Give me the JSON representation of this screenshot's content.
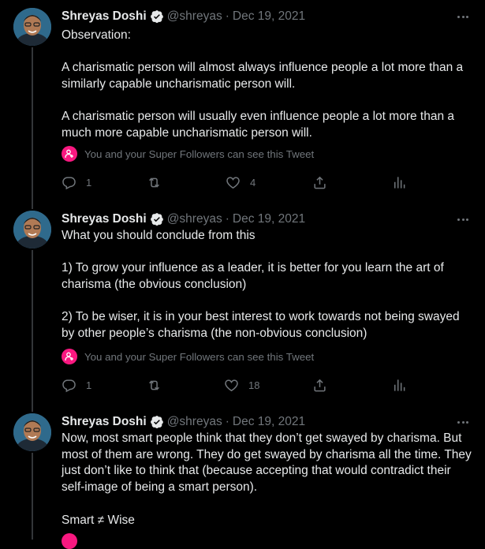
{
  "super_follow_notice": "You and your Super Followers can see this Tweet",
  "tweets": [
    {
      "name": "Shreyas Doshi",
      "handle": "@shreyas",
      "separator": "·",
      "date": "Dec 19, 2021",
      "paragraphs": [
        "Observation:",
        "A charismatic person will almost always influence people a lot more than a similarly capable uncharismatic person will.",
        "A charismatic person will usually even influence people a lot more than a much more capable uncharismatic person will."
      ],
      "reply_count": "1",
      "retweet_count": "",
      "like_count": "4"
    },
    {
      "name": "Shreyas Doshi",
      "handle": "@shreyas",
      "separator": "·",
      "date": "Dec 19, 2021",
      "paragraphs": [
        "What you should conclude from this",
        "1) To grow your influence as a leader, it is better for you learn the art of charisma (the obvious conclusion)",
        "2) To be wiser, it is in your best interest to work towards not being swayed by other people’s charisma (the non-obvious conclusion)"
      ],
      "reply_count": "1",
      "retweet_count": "",
      "like_count": "18"
    },
    {
      "name": "Shreyas Doshi",
      "handle": "@shreyas",
      "separator": "·",
      "date": "Dec 19, 2021",
      "paragraphs": [
        "Now, most smart people think that they don’t get swayed by charisma. But most of them are wrong. They do get swayed by charisma all the time. They just don’t like to think that (because accepting that would contradict their self-image of being a smart person).",
        "Smart ≠ Wise"
      ]
    }
  ],
  "icons": {
    "verified": "verified-badge-icon",
    "more": "more-options-icon",
    "reply": "reply-icon",
    "retweet": "retweet-icon",
    "like": "heart-icon",
    "share": "share-icon",
    "analytics": "analytics-icon",
    "super_follow": "super-follow-icon"
  },
  "colors": {
    "background": "#000000",
    "text": "#e7e9ea",
    "secondary": "#71767b",
    "super_follow": "#f91880"
  }
}
